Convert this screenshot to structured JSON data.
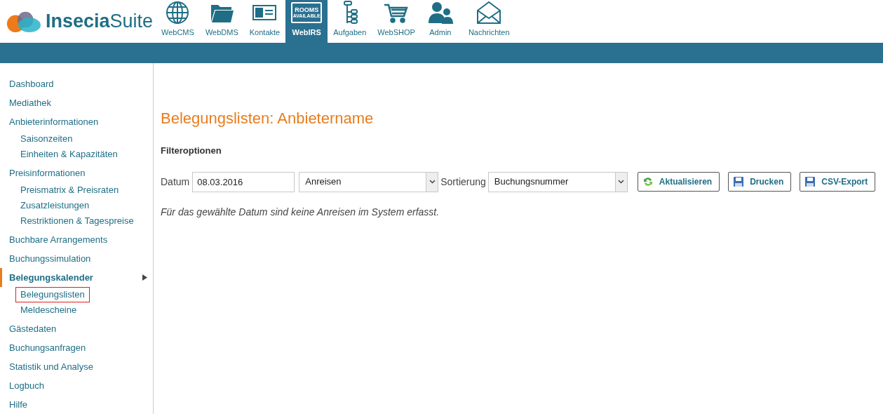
{
  "logo": {
    "text": "**Insecia**Suite"
  },
  "nav": [
    {
      "label": "WebCMS",
      "selected": false
    },
    {
      "label": "WebDMS",
      "selected": false
    },
    {
      "label": "Kontakte",
      "selected": false
    },
    {
      "label": "WebIRS",
      "selected": true,
      "badge_top": "ROOMS",
      "badge_bottom": "AVAILABLE"
    },
    {
      "label": "Aufgaben",
      "selected": false
    },
    {
      "label": "WebSHOP",
      "selected": false
    },
    {
      "label": "Admin",
      "selected": false
    },
    {
      "label": "Nachrichten",
      "selected": false
    }
  ],
  "sidebar": {
    "items": [
      {
        "label": "Dashboard",
        "selected": false
      },
      {
        "label": "Mediathek",
        "selected": false
      },
      {
        "label": "Anbieterinformationen",
        "selected": false,
        "children": [
          {
            "label": "Saisonzeiten",
            "selected": false
          },
          {
            "label": "Einheiten & Kapazitäten",
            "selected": false
          }
        ]
      },
      {
        "label": "Preisinformationen",
        "selected": false,
        "children": [
          {
            "label": "Preismatrix & Preisraten",
            "selected": false
          },
          {
            "label": "Zusatzleistungen",
            "selected": false
          },
          {
            "label": "Restriktionen & Tagespreise",
            "selected": false
          }
        ]
      },
      {
        "label": "Buchbare Arrangements",
        "selected": false
      },
      {
        "label": "Buchungssimulation",
        "selected": false
      },
      {
        "label": "Belegungskalender",
        "selected": true,
        "children": [
          {
            "label": "Belegungslisten",
            "selected": true
          },
          {
            "label": "Meldescheine",
            "selected": false
          }
        ]
      },
      {
        "label": "Gästedaten",
        "selected": false
      },
      {
        "label": "Buchungsanfragen",
        "selected": false
      },
      {
        "label": "Statistik und Analyse",
        "selected": false
      },
      {
        "label": "Logbuch",
        "selected": false
      },
      {
        "label": "Hilfe",
        "selected": false
      }
    ]
  },
  "page": {
    "title": "Belegungslisten: Anbietername",
    "subtitle": "Filteroptionen",
    "filters": {
      "date_label": "Datum",
      "date_value": "08.03.2016",
      "type_value": "Anreisen",
      "sort_label": "Sortierung",
      "sort_value": "Buchungsnummer"
    },
    "buttons": [
      {
        "label": "Aktualisieren",
        "kind": "refresh"
      },
      {
        "label": "Drucken",
        "kind": "save"
      },
      {
        "label": "CSV-Export",
        "kind": "save"
      }
    ],
    "message": "Für das gewählte Datum sind keine Anreisen im System erfasst."
  }
}
